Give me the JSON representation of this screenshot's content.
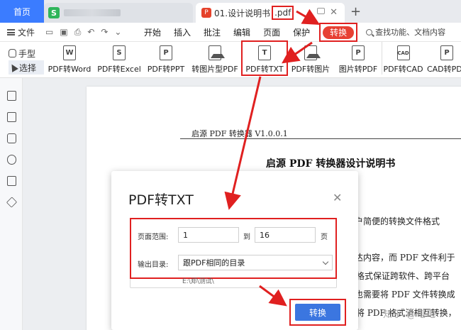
{
  "tabs": {
    "home": "首页",
    "pdf_tab_name": "01.设计说明书",
    "pdf_tab_ext": ".pdf"
  },
  "menu": {
    "file": "文件",
    "items": [
      "开始",
      "插入",
      "批注",
      "编辑",
      "页面",
      "保护"
    ],
    "convert": "转换",
    "search": "查找功能、文档内容"
  },
  "toolbar": {
    "hand": "手型",
    "select": "选择",
    "tools": [
      {
        "label": "PDF转Word",
        "icon": "W"
      },
      {
        "label": "PDF转Excel",
        "icon": "S"
      },
      {
        "label": "PDF转PPT",
        "icon": "P"
      },
      {
        "label": "转图片型PDF",
        "icon": ""
      },
      {
        "label": "PDF转TXT",
        "icon": "T"
      },
      {
        "label": "PDF转图片",
        "icon": ""
      },
      {
        "label": "图片转PDF",
        "icon": "P"
      },
      {
        "label": "PDF转CAD",
        "icon": "CAD"
      },
      {
        "label": "CAD转PDF",
        "icon": "P"
      }
    ]
  },
  "document": {
    "header": "启源 PDF 转换器 V1.0.0.1",
    "title": "启源 PDF 转换器设计说明书",
    "fragments": [
      "用户简便的转换文件格式",
      "达内容，而 PDF 文件利于",
      "格式保证跨软件、跨平台",
      "也需要将 PDF 文件转换成",
      "将 PDF 格式消相互转换，"
    ],
    "watermark": "知乎 @电电"
  },
  "dialog": {
    "title": "PDF转TXT",
    "page_range_label": "页面范围:",
    "page_from": "1",
    "to_label": "到",
    "page_to": "16",
    "page_unit": "页",
    "output_label": "输出目录:",
    "output_value": "跟PDF相同的目录",
    "output_path": "E:\\郑\\测试\\",
    "convert_button": "转换"
  }
}
